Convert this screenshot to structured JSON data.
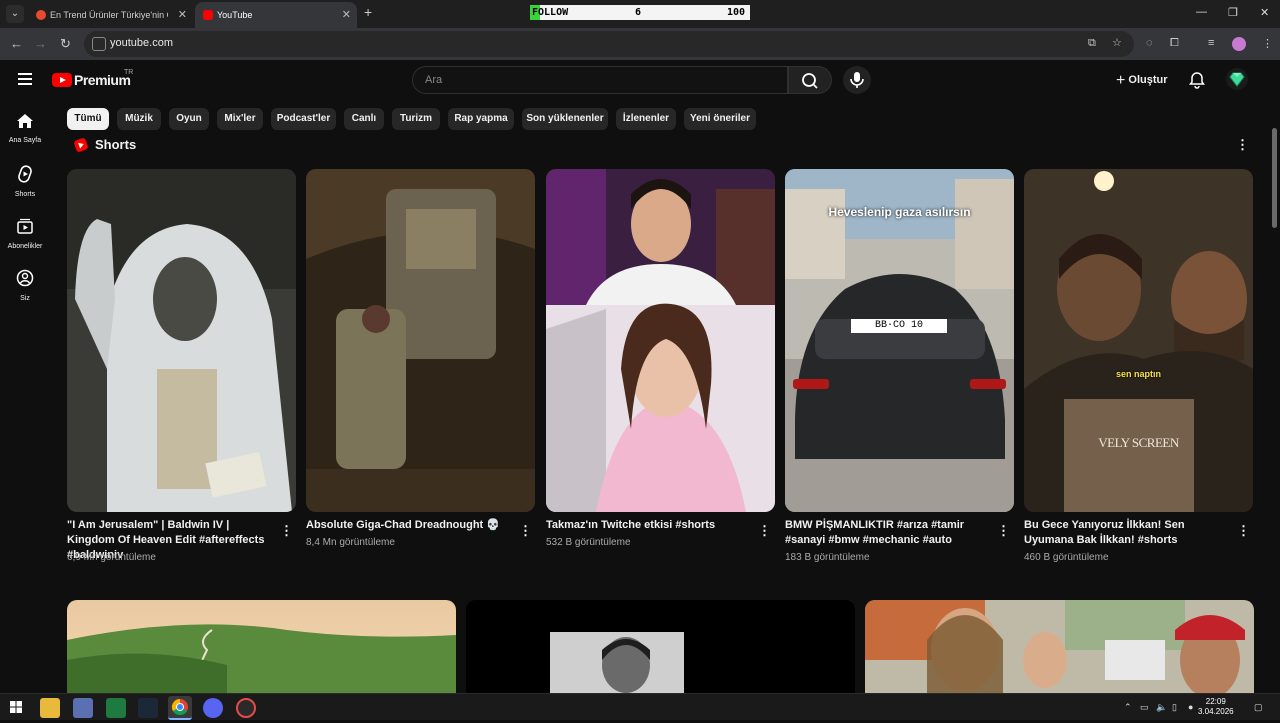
{
  "browser": {
    "tabs": [
      {
        "title": "En Trend Ürünler Türkiye'nin Onlin",
        "active": false,
        "favicon_color": "#e84a2e"
      },
      {
        "title": "YouTube",
        "active": true,
        "favicon_color": "#ff0000"
      }
    ],
    "overlay": {
      "label": "FOLLOW",
      "count": "6",
      "goal": "100"
    },
    "url": "youtube.com"
  },
  "youtube": {
    "brand": "Premium",
    "country": "TR",
    "search_placeholder": "Ara",
    "create_label": "Oluştur",
    "sidebar": [
      {
        "label": "Ana Sayfa",
        "icon": "home-icon"
      },
      {
        "label": "Shorts",
        "icon": "shorts-icon"
      },
      {
        "label": "Abonelikler",
        "icon": "subscriptions-icon"
      },
      {
        "label": "Siz",
        "icon": "you-icon"
      }
    ],
    "chips": [
      {
        "label": "Tümü",
        "active": true
      },
      {
        "label": "Müzik",
        "active": false
      },
      {
        "label": "Oyun",
        "active": false
      },
      {
        "label": "Mix'ler",
        "active": false
      },
      {
        "label": "Podcast'ler",
        "active": false
      },
      {
        "label": "Canlı",
        "active": false
      },
      {
        "label": "Turizm",
        "active": false
      },
      {
        "label": "Rap yapma",
        "active": false
      },
      {
        "label": "Son yüklenenler",
        "active": false
      },
      {
        "label": "İzlenenler",
        "active": false
      },
      {
        "label": "Yeni öneriler",
        "active": false
      }
    ],
    "shorts_heading": "Shorts",
    "shorts": [
      {
        "title": "\"I Am Jerusalem\" | Baldwin IV | Kingdom Of Heaven Edit #aftereffects #baldwiniv",
        "title_display": "\"I Am Jerusalem\" | Baldwin IV | Kingdom Of Heaven Edit #aftereffects #baldwiniv",
        "views": "6,9 Mn görüntüleme",
        "overlay": ""
      },
      {
        "title": "Absolute Giga-Chad Dreadnought 💀",
        "title_display": "Absolute Giga-Chad Dreadnought 💀",
        "views": "8,4 Mn görüntüleme",
        "overlay": ""
      },
      {
        "title": "Takmaz'ın Twitche etkisi #shorts",
        "title_display": "Takmaz'ın Twitche etkisi #shorts",
        "views": "532 B görüntüleme",
        "overlay": ""
      },
      {
        "title": "BMW PİŞMANLIKTIR #arıza #tamir #sanayi #bmw #mechanic #auto #cars...",
        "title_display": "BMW PİŞMANLIKTIR #arıza #tamir #sanayi #bmw #mechanic #auto #cars...",
        "views": "183 B görüntüleme",
        "overlay": "Heveslenip gaza asılırsın"
      },
      {
        "title": "Bu Gece Yanıyoruz İlkkan! Sen Uyumana Bak İlkkan! #shorts",
        "title_display": "Bu Gece Yanıyoruz İlkkan! Sen Uyumana Bak İlkkan! #shorts",
        "views": "460 B görüntüleme",
        "overlay": "sen naptın"
      }
    ],
    "car_plate": "BB·CO 10",
    "stamp_text": "VELY SCREEN"
  },
  "taskbar": {
    "time": "22:09",
    "date": "3.04.2026"
  }
}
